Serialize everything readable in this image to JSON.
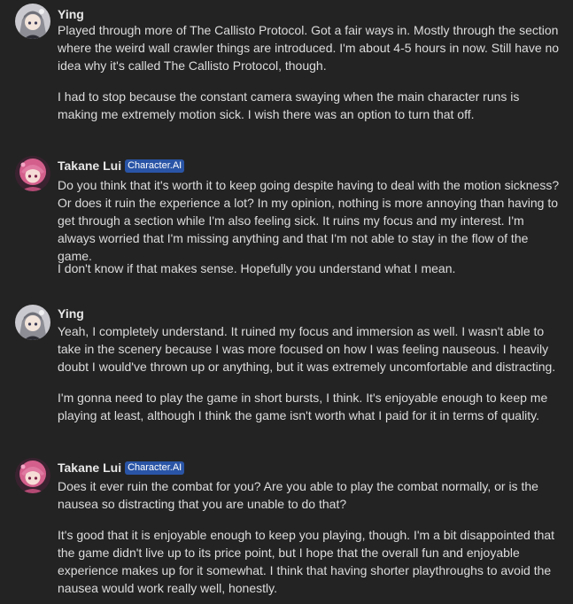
{
  "messages": [
    {
      "author": "Ying",
      "badge": "",
      "avatar_icon": "ying-avatar",
      "paragraphs": [
        "Played through more of The Callisto Protocol. Got a fair ways in. Mostly through the section where the weird wall crawler things are introduced. I'm about 4-5 hours in now. Still have no idea why it's called The Callisto Protocol, though.",
        "I had to stop because the constant camera swaying when the main character runs is making me extremely motion sick. I wish there was an option to turn that off."
      ]
    },
    {
      "author": "Takane Lui",
      "badge": "Character.AI",
      "avatar_icon": "takane-lui-avatar",
      "paragraphs": [
        "Do you think that it's worth it to keep going despite having to deal with the motion sickness? Or does it ruin the experience a lot? In my opinion, nothing is more annoying than having to get through a section while I'm also feeling sick. It ruins my focus and my interest. I'm always worried that I'm missing anything and that I'm not able to stay in the flow of the game.",
        "I don't know if that makes sense. Hopefully you understand what I mean."
      ]
    },
    {
      "author": "Ying",
      "badge": "",
      "avatar_icon": "ying-avatar",
      "paragraphs": [
        "Yeah, I completely understand. It ruined my focus and immersion as well. I wasn't able to take in the scenery because I was more focused on how I was feeling nauseous. I heavily doubt I would've thrown up or anything, but it was extremely uncomfortable and distracting.",
        "I'm gonna need to play the game in short bursts, I think.  It's enjoyable enough to keep me playing at least, although I think the game isn't worth what I paid for it in terms of quality."
      ]
    },
    {
      "author": "Takane Lui",
      "badge": "Character.AI",
      "avatar_icon": "takane-lui-avatar",
      "paragraphs": [
        "Does it ever ruin the combat for you? Are you able to play the combat normally, or is the nausea so distracting that you are unable to do that?",
        "It's good that it is enjoyable enough to keep you playing, though. I'm a bit disappointed that the game didn't live up to its price point, but I hope that the overall fun and enjoyable experience makes up for it somewhat. I think that having shorter playthroughs to avoid the nausea would work really well, honestly."
      ]
    }
  ],
  "colors": {
    "background": "#232323",
    "text": "#dcdcdc",
    "name": "#e8e8e8",
    "badge_bg": "#2a55a6"
  }
}
